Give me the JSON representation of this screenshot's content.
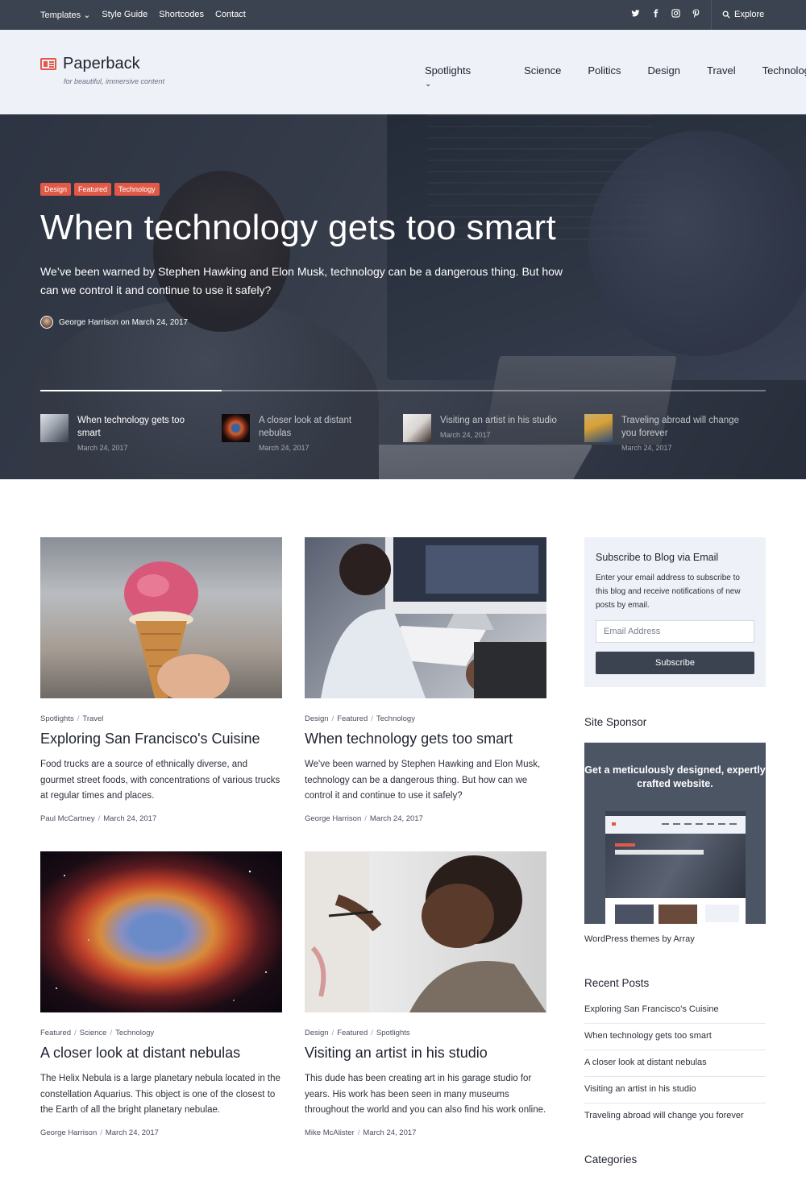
{
  "topbar": {
    "nav": [
      "Templates",
      "Style Guide",
      "Shortcodes",
      "Contact"
    ],
    "social_icons": [
      "twitter-icon",
      "facebook-icon",
      "instagram-icon",
      "pinterest-icon"
    ],
    "explore_label": "Explore"
  },
  "header": {
    "site_title": "Paperback",
    "tagline": "for beautiful, immersive content",
    "nav": [
      "Spotlights",
      "Science",
      "Politics",
      "Design",
      "Travel",
      "Technology"
    ]
  },
  "hero": {
    "categories": [
      "Design",
      "Featured",
      "Technology"
    ],
    "title": "When technology gets too smart",
    "excerpt": "We’ve been warned by Stephen Hawking and Elon Musk, technology can be a dangerous thing. But how can we control it and continue to use it safely?",
    "byline": "George Harrison on March 24, 2017",
    "progress": 0.25,
    "slides": [
      {
        "title": "When technology gets too smart",
        "date": "March 24, 2017"
      },
      {
        "title": "A closer look at distant nebulas",
        "date": "March 24, 2017"
      },
      {
        "title": "Visiting an artist in his studio",
        "date": "March 24, 2017"
      },
      {
        "title": "Traveling abroad will change you forever",
        "date": "March 24, 2017"
      }
    ]
  },
  "posts": [
    {
      "categories": [
        "Spotlights",
        "Travel"
      ],
      "title": "Exploring San Francisco's Cuisine",
      "excerpt": "Food trucks are a source of ethnically diverse, and gourmet street foods, with concentrations of various trucks at regular times and places.",
      "author": "Paul McCartney",
      "date": "March 24, 2017"
    },
    {
      "categories": [
        "Design",
        "Featured",
        "Technology"
      ],
      "title": "When technology gets too smart",
      "excerpt": "We've been warned by Stephen Hawking and Elon Musk, technology can be a dangerous thing. But how can we control it and continue to use it safely?",
      "author": "George Harrison",
      "date": "March 24, 2017"
    },
    {
      "categories": [
        "Featured",
        "Science",
        "Technology"
      ],
      "title": "A closer look at distant nebulas",
      "excerpt": "The Helix Nebula is a large planetary nebula located in the constellation Aquarius. This object is one of the closest to the Earth of all the bright planetary nebulae.",
      "author": "George Harrison",
      "date": "March 24, 2017"
    },
    {
      "categories": [
        "Design",
        "Featured",
        "Spotlights"
      ],
      "title": "Visiting an artist in his studio",
      "excerpt": "This dude has been creating art in his garage studio for years. His work has been seen in many museums throughout the world and you can also find his work online.",
      "author": "Mike McAlister",
      "date": "March 24, 2017"
    }
  ],
  "sidebar": {
    "subscribe": {
      "title": "Subscribe to Blog via Email",
      "description": "Enter your email address to subscribe to this blog and receive notifications of new posts by email.",
      "placeholder": "Email Address",
      "button_label": "Subscribe"
    },
    "sponsor": {
      "title": "Site Sponsor",
      "headline": "Get a meticulously designed, expertly crafted website.",
      "caption": "WordPress themes by Array"
    },
    "recent": {
      "title": "Recent Posts",
      "items": [
        "Exploring San Francisco's Cuisine",
        "When technology gets too smart",
        "A closer look at distant nebulas",
        "Visiting an artist in his studio",
        "Traveling abroad will change you forever"
      ]
    },
    "categories_title": "Categories"
  },
  "colors": {
    "accent": "#e05a47",
    "topbar": "#3b4250",
    "header_bg": "#eef1f8"
  }
}
